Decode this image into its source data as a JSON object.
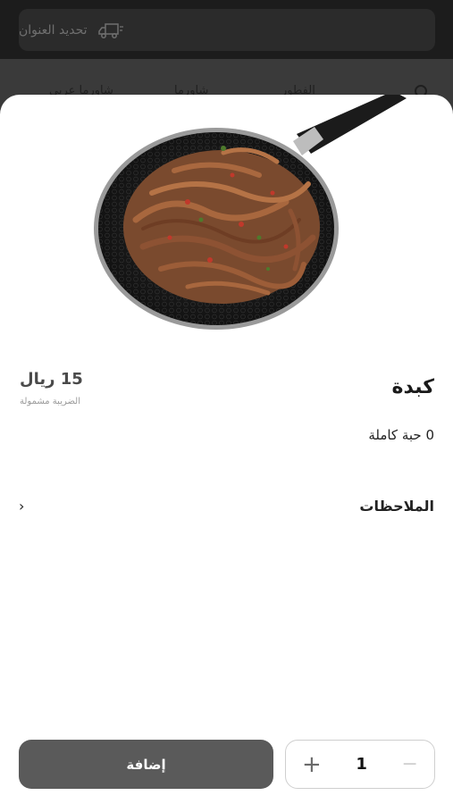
{
  "header": {
    "address_placeholder": "تحديد العنوان",
    "truck_icon": "delivery-truck-icon",
    "categories": [
      "شاورما عربي",
      "شاورما",
      "الفطور"
    ],
    "search_icon": "search-icon"
  },
  "product": {
    "title": "كبدة",
    "price": "15 ريال",
    "tax_note": "الضريبة مشمولة",
    "option": "0 حبة كاملة",
    "notes_label": "الملاحظات",
    "chevron": "›"
  },
  "footer": {
    "add_label": "إضافة",
    "quantity": "1",
    "plus": "+",
    "minus": "−"
  },
  "colors": {
    "add_button": "#5a5a5a",
    "overlay": "#1c1c1c"
  }
}
